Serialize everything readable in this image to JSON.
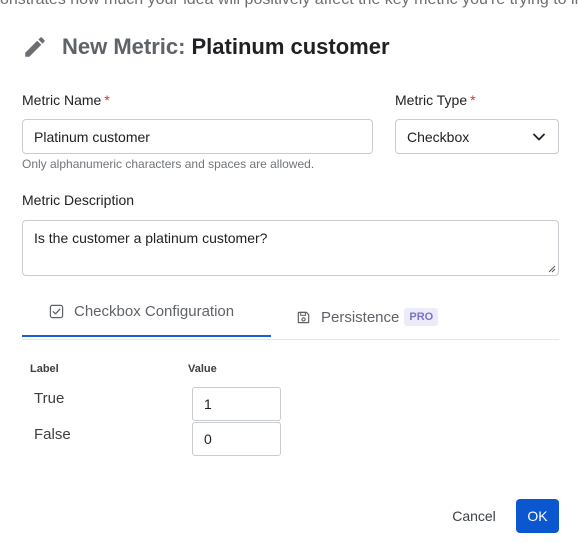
{
  "background_text": "onstrates how much your idea will positively affect the key metric you're trying to im",
  "dialog": {
    "title_prefix": "New Metric:",
    "title_name": "Platinum customer",
    "title_icon": "pencil-icon"
  },
  "form": {
    "metric_name_label": "Metric Name",
    "metric_name_value": "Platinum customer",
    "metric_name_hint": "Only alphanumeric characters and spaces are allowed.",
    "metric_type_label": "Metric Type",
    "metric_type_value": "Checkbox",
    "required_marker": "*",
    "description_label": "Metric Description",
    "description_value": "Is the customer a platinum customer?"
  },
  "tabs": [
    {
      "label": "Checkbox Configuration",
      "icon": "checkbox-icon",
      "active": true
    },
    {
      "label": "Persistence",
      "icon": "save-icon",
      "active": false,
      "badge": "PRO"
    }
  ],
  "config": {
    "label_header": "Label",
    "value_header": "Value",
    "rows": [
      {
        "label": "True",
        "value": "1"
      },
      {
        "label": "False",
        "value": "0"
      }
    ]
  },
  "footer": {
    "cancel_label": "Cancel",
    "ok_label": "OK"
  },
  "colors": {
    "accent": "#0b57d0",
    "required": "#d93025",
    "pro_badge_bg": "#ecebfa",
    "pro_badge_text": "#7b73c9"
  }
}
